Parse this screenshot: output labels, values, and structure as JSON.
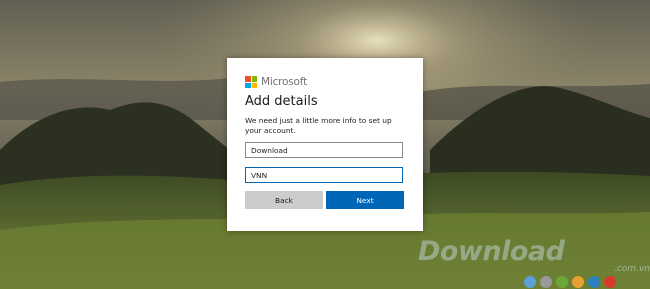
{
  "brand": {
    "name": "Microsoft",
    "logo_colors": [
      "#f25022",
      "#7fba00",
      "#00a4ef",
      "#ffb900"
    ]
  },
  "dialog": {
    "title": "Add details",
    "description": "We need just a little more info to set up your account.",
    "first_field": {
      "value": "Download"
    },
    "second_field": {
      "value": "VNN"
    },
    "back_label": "Back",
    "next_label": "Next",
    "accent_color": "#0067b8"
  },
  "watermark": {
    "text": "Download",
    "domain": ".com.vn",
    "dot_colors": [
      "#5aa0d8",
      "#9a9a9a",
      "#6aa83a",
      "#e8a030",
      "#2c7fc0",
      "#d83a2a"
    ]
  }
}
